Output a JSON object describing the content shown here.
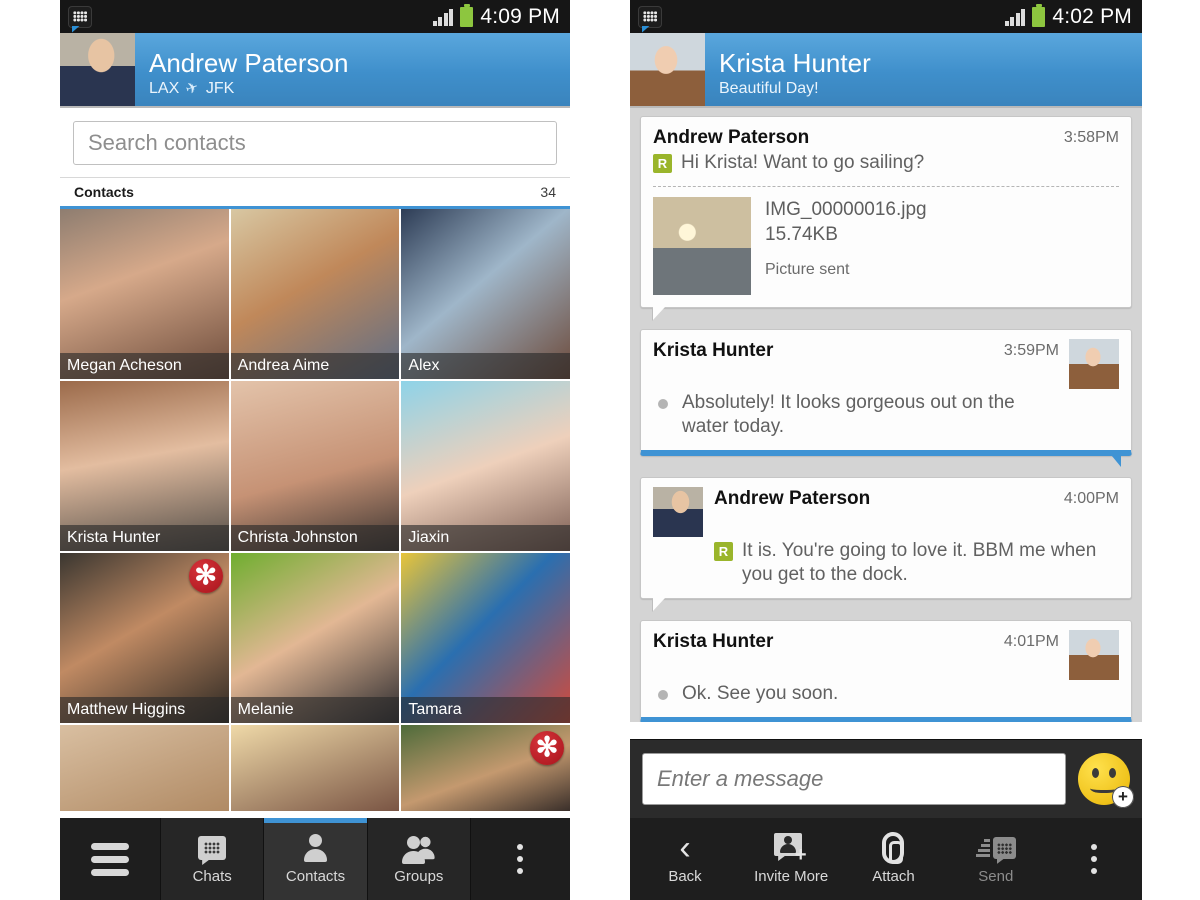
{
  "left_phone": {
    "status_bar": {
      "app_icon": "bbm-icon",
      "signal_icon": "signal-icon",
      "battery_icon": "battery-icon",
      "clock": "4:09 PM"
    },
    "profile": {
      "name": "Andrew Paterson",
      "status_origin": "LAX",
      "status_icon": "airplane-icon",
      "status_destination": "JFK"
    },
    "search": {
      "placeholder": "Search contacts",
      "value": ""
    },
    "section": {
      "title": "Contacts",
      "count": "34"
    },
    "contacts": [
      {
        "name": "Megan Acheson",
        "photo": "ph-megan",
        "badge": ""
      },
      {
        "name": "Andrea Aime",
        "photo": "ph-andrea",
        "badge": ""
      },
      {
        "name": "Alex",
        "photo": "ph-alex",
        "badge": ""
      },
      {
        "name": "Krista Hunter",
        "photo": "ph-krista2",
        "badge": ""
      },
      {
        "name": "Christa Johnston",
        "photo": "ph-christa",
        "badge": ""
      },
      {
        "name": "Jiaxin",
        "photo": "ph-jiaxin",
        "badge": ""
      },
      {
        "name": "Matthew Higgins",
        "photo": "ph-matthew",
        "badge": "✻"
      },
      {
        "name": "Melanie",
        "photo": "ph-melanie",
        "badge": ""
      },
      {
        "name": "Tamara",
        "photo": "ph-tamara",
        "badge": ""
      }
    ],
    "contacts_partial": [
      {
        "name": "",
        "photo": "ph-p1",
        "badge": ""
      },
      {
        "name": "",
        "photo": "ph-p2",
        "badge": ""
      },
      {
        "name": "",
        "photo": "ph-p3",
        "badge": "✻"
      }
    ],
    "nav": [
      {
        "label": "",
        "icon": "hamburger-icon",
        "active": false
      },
      {
        "label": "Chats",
        "icon": "bbm-chats-icon",
        "active": false
      },
      {
        "label": "Contacts",
        "icon": "contact-person-icon",
        "active": true
      },
      {
        "label": "Groups",
        "icon": "groups-people-icon",
        "active": false
      },
      {
        "label": "",
        "icon": "overflow-kebab-icon",
        "active": false
      }
    ]
  },
  "right_phone": {
    "status_bar": {
      "app_icon": "bbm-icon",
      "signal_icon": "signal-icon",
      "battery_icon": "battery-icon",
      "clock": "4:02 PM"
    },
    "profile": {
      "name": "Krista Hunter",
      "status": "Beautiful Day!"
    },
    "messages": [
      {
        "sender": "Andrew Paterson",
        "time": "3:58PM",
        "text": "Hi Krista! Want to go sailing?",
        "status_badge": "R",
        "direction": "outgoing",
        "avatar_side": "none",
        "attachment": {
          "filename": "IMG_00000016.jpg",
          "size": "15.74KB",
          "status": "Picture sent",
          "thumb": "ph-sail"
        }
      },
      {
        "sender": "Krista Hunter",
        "time": "3:59PM",
        "text": "Absolutely! It looks gorgeous out on the water today.",
        "status_badge": "",
        "direction": "incoming",
        "avatar_side": "right",
        "avatar": "ph-krista"
      },
      {
        "sender": "Andrew Paterson",
        "time": "4:00PM",
        "text": "It is. You're going to love it. BBM me when you get to the dock.",
        "status_badge": "R",
        "direction": "outgoing",
        "avatar_side": "left",
        "avatar": "ph-andrew"
      },
      {
        "sender": "Krista Hunter",
        "time": "4:01PM",
        "text": "Ok. See you soon.",
        "status_badge": "",
        "direction": "incoming",
        "avatar_side": "right",
        "avatar": "ph-krista"
      }
    ],
    "compose": {
      "placeholder": "Enter a message",
      "value": "",
      "emoji_icon": "smiley-plus-icon"
    },
    "nav": [
      {
        "label": "Back",
        "icon": "chevron-left-icon",
        "disabled": false
      },
      {
        "label": "Invite More",
        "icon": "invite-person-add-icon",
        "disabled": false
      },
      {
        "label": "Attach",
        "icon": "paperclip-icon",
        "disabled": false
      },
      {
        "label": "Send",
        "icon": "send-bbm-icon",
        "disabled": true
      },
      {
        "label": "",
        "icon": "overflow-kebab-icon",
        "disabled": false
      }
    ]
  },
  "colors": {
    "accent_blue": "#3f93d4",
    "header_blue": "#4a97d2",
    "badge_red": "#b8232b",
    "read_green": "#9ab52b",
    "battery_green": "#8dc63f"
  }
}
